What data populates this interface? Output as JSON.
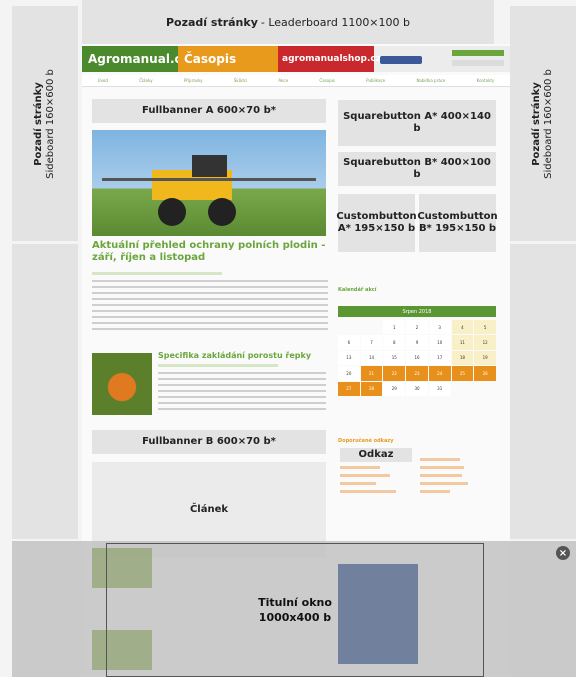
{
  "leaderboard": {
    "title": "Pozadí stránky",
    "rest": "- Leaderboard  1100×100 b"
  },
  "sideboard_left": {
    "title": "Pozadí stránky",
    "sub": "Sideboard 160×600 b"
  },
  "sideboard_right": {
    "title": "Pozadí stránky",
    "sub": "Sideboard 160×600 b"
  },
  "header": {
    "logo_agromanual": "Agromanual.cz",
    "logo_casopis": "Časopis",
    "logo_shop": "agromanualshop.cz"
  },
  "nav": [
    "Úvod",
    "Články",
    "Přípravky",
    "Škůdci",
    "Akce",
    "Časopis",
    "Publikace",
    "Nabídka práce",
    "Kontakty"
  ],
  "fullbanner_a": "Fullbanner A  600×70 b*",
  "fullbanner_b": "Fullbanner B  600×70 b*",
  "squarebutton_a": "Squarebutton A* 400×140 b",
  "squarebutton_b": "Squarebutton B* 400×100 b",
  "custombutton_a": "Custombutton A* 195×150 b",
  "custombutton_b": "Custombutton B* 195×150 b",
  "article1_title": "Aktuální přehled ochrany polních plodin - září, říjen a listopad",
  "article2_title": "Specifika zakládání porostu řepky",
  "calendar": {
    "heading": "Kalendář akcí",
    "month": "Srpen 2018",
    "days": [
      "",
      "",
      "1",
      "2",
      "3",
      "4",
      "5",
      "6",
      "7",
      "8",
      "9",
      "10",
      "11",
      "12",
      "13",
      "14",
      "15",
      "16",
      "17",
      "18",
      "19",
      "20",
      "21",
      "22",
      "23",
      "24",
      "25",
      "26",
      "27",
      "28",
      "29",
      "30",
      "31",
      "",
      ""
    ]
  },
  "links_heading": "Doporučené odkazy",
  "odkaz": "Odkaz",
  "clanek": "Článek",
  "popup": {
    "line1": "Titulní okno",
    "line2": "1000x400 b"
  },
  "close_glyph": "×"
}
